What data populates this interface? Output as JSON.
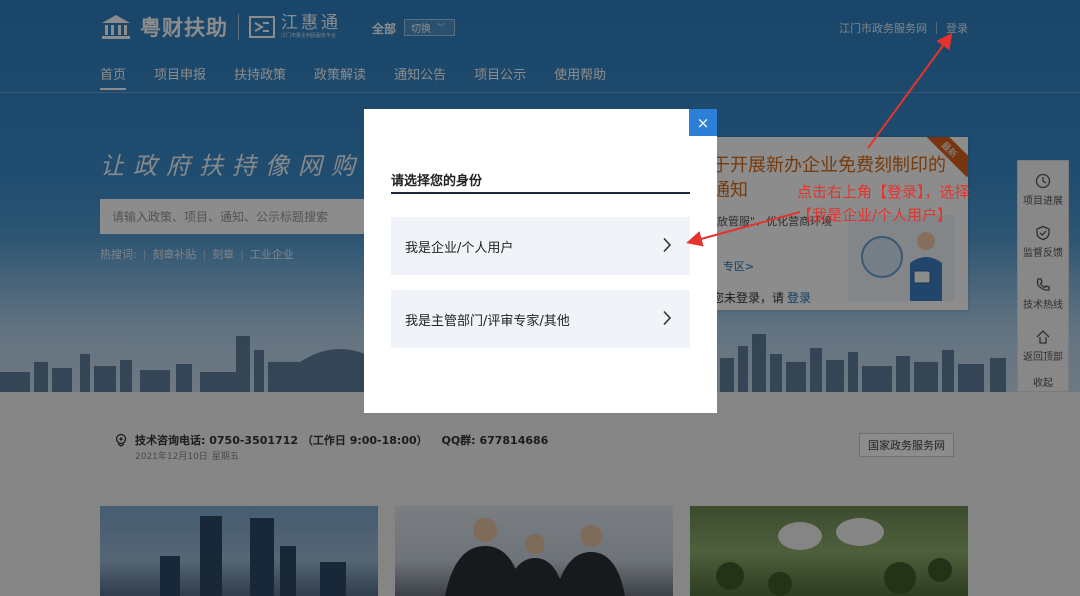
{
  "header": {
    "brand_name": "粤财扶助",
    "brand2_name": "江惠通",
    "brand2_sub": "江门市惠企利民服务平台",
    "scope": "全部",
    "switch_label": "切换",
    "gov_site": "江门市政务服务网",
    "login": "登录"
  },
  "nav": {
    "items": [
      {
        "label": "首页",
        "active": true
      },
      {
        "label": "项目申报"
      },
      {
        "label": "扶持政策"
      },
      {
        "label": "政策解读"
      },
      {
        "label": "通知公告"
      },
      {
        "label": "项目公示"
      },
      {
        "label": "使用帮助"
      }
    ]
  },
  "hero": {
    "slogan": "让政府扶持像网购一样",
    "search_placeholder": "请输入政策、项目、通知、公示标题搜索",
    "hot_label": "热搜词:",
    "hot_words": [
      "刻章补贴",
      "刻章",
      "工业企业"
    ]
  },
  "notice": {
    "title": "于开展新办企业免费刻制印的通知",
    "desc": "\"放管服\"、优化营商环境",
    "link": "、专区>",
    "login_prompt": "您未登录，请",
    "login_link": "登录",
    "ribbon": "最新"
  },
  "side": {
    "items": [
      "项目进展",
      "监督反馈",
      "技术热线",
      "返回顶部"
    ],
    "collapse": "收起"
  },
  "contact": {
    "phone_label": "技术咨询电话:",
    "phone": "0750-3501712",
    "hours": "（工作日 9:00-18:00）",
    "qq_label": "QQ群:",
    "qq": "677814686",
    "date": "2021年12月10日",
    "weekday": "星期五",
    "gov_button": "国家政务服务网"
  },
  "modal": {
    "close": "×",
    "title": "请选择您的身份",
    "options": [
      "我是企业/个人用户",
      "我是主管部门/评审专家/其他"
    ]
  },
  "annotation": {
    "line1": "点击右上角【登录】，选择",
    "line2": "【我是企业/个人用户】",
    "color": "#e5332d"
  },
  "colors": {
    "primary": "#2b7fd6",
    "notice_orange": "#d96b13"
  }
}
